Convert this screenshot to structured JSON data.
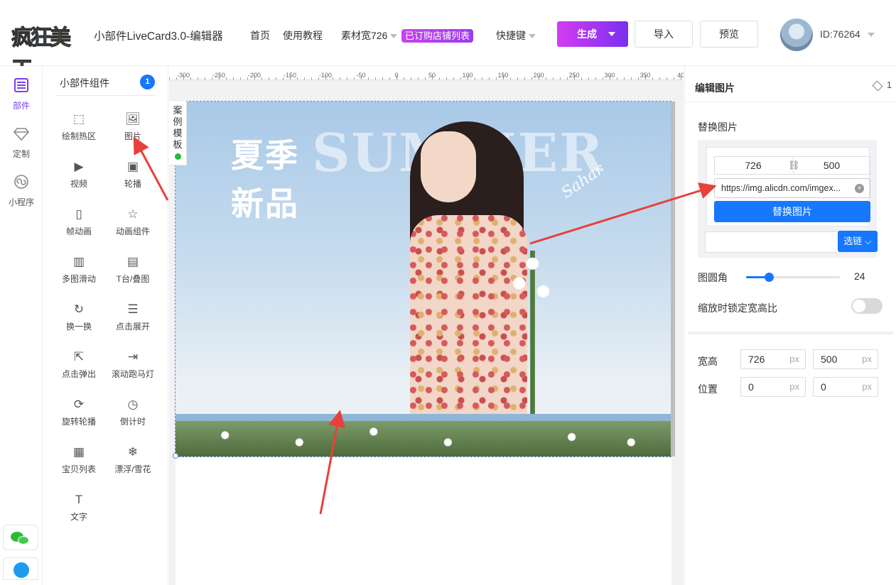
{
  "header": {
    "logo_text": "疯狂美工",
    "app_title": "小部件LiveCard3.0-编辑器",
    "nav_home": "首页",
    "nav_tutorial": "使用教程",
    "nav_material_width": "素材宽726",
    "badge_shop_list": "已订购店铺列表",
    "nav_shortcuts": "快捷键",
    "btn_generate": "生成",
    "btn_import": "导入",
    "btn_preview": "预览",
    "user_id": "ID:76264"
  },
  "sidebar": {
    "items": [
      {
        "label": "部件",
        "icon": "list-icon",
        "active": true
      },
      {
        "label": "定制",
        "icon": "diamond-icon",
        "active": false
      },
      {
        "label": "小程序",
        "icon": "miniprogram-icon",
        "active": false
      }
    ]
  },
  "widgets": {
    "title": "小部件组件",
    "count": "1",
    "items": [
      {
        "label": "绘制热区",
        "icon": "hotzone-icon",
        "glyph": "⬚"
      },
      {
        "label": "图片",
        "icon": "image-icon",
        "glyph": "🖼"
      },
      {
        "label": "视频",
        "icon": "video-icon",
        "glyph": "▶"
      },
      {
        "label": "轮播",
        "icon": "carousel-icon",
        "glyph": "▣"
      },
      {
        "label": "帧动画",
        "icon": "frame-animation-icon",
        "glyph": "▯"
      },
      {
        "label": "动画组件",
        "icon": "star-icon",
        "glyph": "☆"
      },
      {
        "label": "多图滑动",
        "icon": "multi-slide-icon",
        "glyph": "▥"
      },
      {
        "label": "T台/叠图",
        "icon": "stack-icon",
        "glyph": "▤"
      },
      {
        "label": "换一换",
        "icon": "refresh-icon",
        "glyph": "↻"
      },
      {
        "label": "点击展开",
        "icon": "expand-icon",
        "glyph": "☰"
      },
      {
        "label": "点击弹出",
        "icon": "popup-icon",
        "glyph": "⇱"
      },
      {
        "label": "滚动跑马灯",
        "icon": "marquee-icon",
        "glyph": "⇥"
      },
      {
        "label": "旋转轮播",
        "icon": "rotate-icon",
        "glyph": "⟳"
      },
      {
        "label": "倒计时",
        "icon": "clock-icon",
        "glyph": "◷"
      },
      {
        "label": "宝贝列表",
        "icon": "grid-list-icon",
        "glyph": "▦"
      },
      {
        "label": "漂浮/雪花",
        "icon": "snowflake-icon",
        "glyph": "❄"
      },
      {
        "label": "文字",
        "icon": "text-icon",
        "glyph": "T"
      }
    ]
  },
  "canvas": {
    "ruler_labels": [
      "-300",
      "-250",
      "-200",
      "-150",
      "-100",
      "-50",
      "0",
      "50",
      "100",
      "150",
      "200",
      "250",
      "300",
      "350",
      "40"
    ],
    "case_tab": "案例模板",
    "image": {
      "headline_cn_line1": "夏季",
      "headline_cn_line2": "新品",
      "headline_en": "SUMMER",
      "signature": "Sahar"
    }
  },
  "right_panel": {
    "title": "编辑图片",
    "layer_count": "1",
    "replace_label": "替换图片",
    "img_width": "726",
    "img_height": "500",
    "url": "https://img.alicdn.com/imgex...",
    "btn_replace": "替换图片",
    "link_value": "",
    "btn_pick_link": "选链",
    "radius_label": "图圆角",
    "radius_value": "24",
    "radius_max": 100,
    "lock_ratio_label": "缩放时锁定宽高比",
    "lock_ratio_on": false,
    "size_label": "宽高",
    "size_width": "726",
    "size_height": "500",
    "pos_label": "位置",
    "pos_x": "0",
    "pos_y": "0",
    "unit": "px"
  },
  "colors": {
    "accent": "#1677ff",
    "brand_gradient_start": "#d23df0",
    "brand_gradient_end": "#7b2ff0",
    "annotation_red": "#e8403a"
  }
}
